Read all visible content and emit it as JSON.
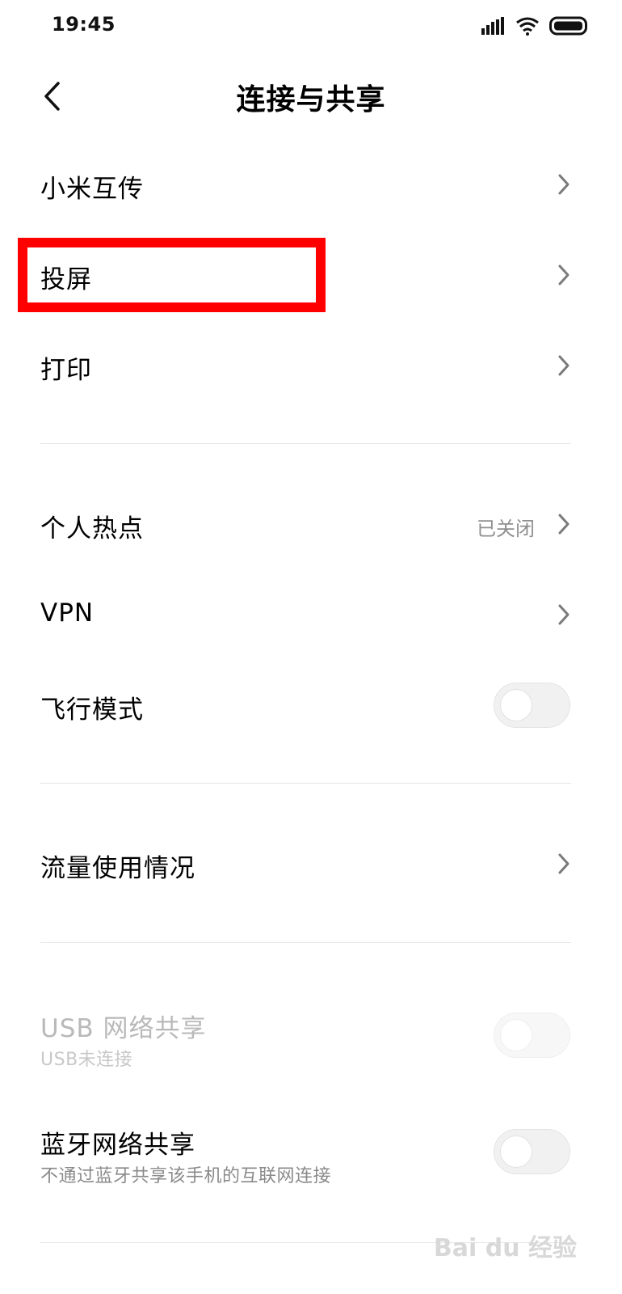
{
  "status": {
    "time": "19:45"
  },
  "header": {
    "title": "连接与共享"
  },
  "items": [
    {
      "label": "小米互传"
    },
    {
      "label": "投屏"
    },
    {
      "label": "打印"
    },
    {
      "label": "个人热点",
      "value": "已关闭"
    },
    {
      "label": "VPN"
    },
    {
      "label": "飞行模式",
      "toggle": false
    },
    {
      "label": "流量使用情况"
    },
    {
      "label": "USB 网络共享",
      "sub": "USB未连接",
      "toggle": false,
      "disabled": true
    },
    {
      "label": "蓝牙网络共享",
      "sub": "不通过蓝牙共享该手机的互联网连接",
      "toggle": false
    }
  ],
  "annotation": {
    "color": "#ff0000"
  },
  "watermark": {
    "text": "Bai du 经验"
  }
}
